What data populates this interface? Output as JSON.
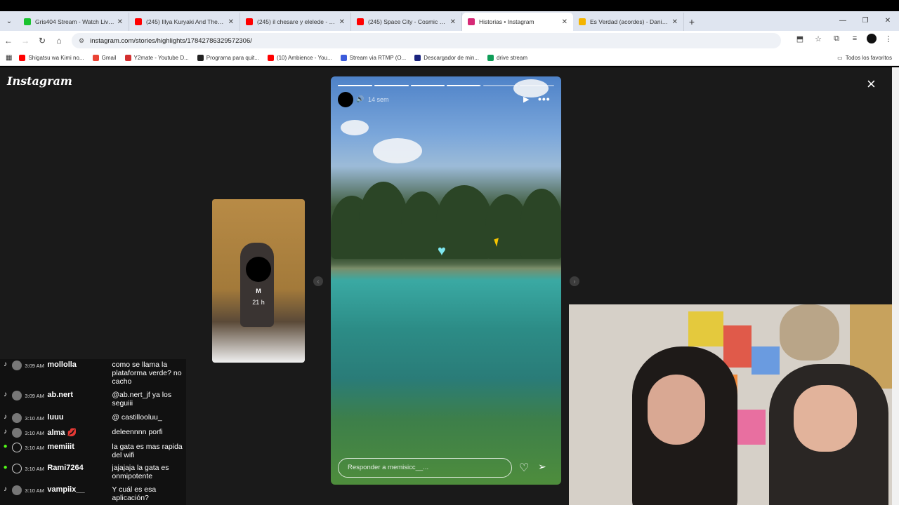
{
  "browser": {
    "tabs": [
      {
        "title": "Gris404 Stream - Watch Live on",
        "fav_color": "#19c32f",
        "active": false
      },
      {
        "title": "(245) Illya Kuryaki And The Vald",
        "fav_color": "#ff0000",
        "active": false
      },
      {
        "title": "(245) il chesare y elelede - You",
        "fav_color": "#ff0000",
        "active": false
      },
      {
        "title": "(245) Space City - Cosmic Musi",
        "fav_color": "#ff0000",
        "active": false
      },
      {
        "title": "Historias • Instagram",
        "fav_color": "#d62976",
        "active": true
      },
      {
        "title": "Es Verdad (acordes) - Daniel, M",
        "fav_color": "#f4b400",
        "active": false
      }
    ],
    "url": "instagram.com/stories/highlights/17842786329572306/",
    "bookmarks": [
      {
        "label": "Shigatsu wa Kimi no...",
        "color": "#ff0000"
      },
      {
        "label": "Gmail",
        "color": "#ea4335"
      },
      {
        "label": "Y2mate - Youtube D...",
        "color": "#d32f2f"
      },
      {
        "label": "Programa para quit...",
        "color": "#222222"
      },
      {
        "label": "(10) Ambience - You...",
        "color": "#ff0000"
      },
      {
        "label": "Stream via RTMP (O...",
        "color": "#3b5bdb"
      },
      {
        "label": "Descargador de min...",
        "color": "#1a237e"
      },
      {
        "label": "drive stream",
        "color": "#0f9d58"
      }
    ],
    "bookmarks_right": "Todos los favoritos"
  },
  "instagram": {
    "logo": "Instagram",
    "close_label": "×",
    "prev_story": {
      "username": "M",
      "time": "21 h"
    },
    "story": {
      "time_ago": "14 sem",
      "progress": [
        1,
        1,
        1,
        0.95,
        0,
        0
      ],
      "reply_placeholder": "Responder a memisicc__..."
    }
  },
  "chat": {
    "messages": [
      {
        "platform": "tiktok",
        "time": "3:09 AM",
        "user": "mollolla",
        "text": "como se llama la plataforma verde? no cacho"
      },
      {
        "platform": "tiktok",
        "time": "3:09 AM",
        "user": "ab.nert",
        "text": "@ab.nert_jf ya los seguiii"
      },
      {
        "platform": "tiktok",
        "time": "3:10 AM",
        "user": "luuu",
        "text": "@ castillooluu_"
      },
      {
        "platform": "tiktok",
        "time": "3:10 AM",
        "user": "alma 💋",
        "text": "deleennnn porfi"
      },
      {
        "platform": "kick",
        "time": "3:10 AM",
        "user": "memiiit",
        "text": "la gata es mas rapida del wifi"
      },
      {
        "platform": "kick",
        "time": "3:10 AM",
        "user": "Rami7264",
        "text": "jajajaja la gata es onmipotente"
      },
      {
        "platform": "tiktok",
        "time": "3:10 AM",
        "user": "vampiix__",
        "text": "Y cuál es esa aplicación?"
      }
    ]
  },
  "colors": {
    "viewer_bg": "#1a1a1a",
    "kick_green": "#53fc18"
  }
}
